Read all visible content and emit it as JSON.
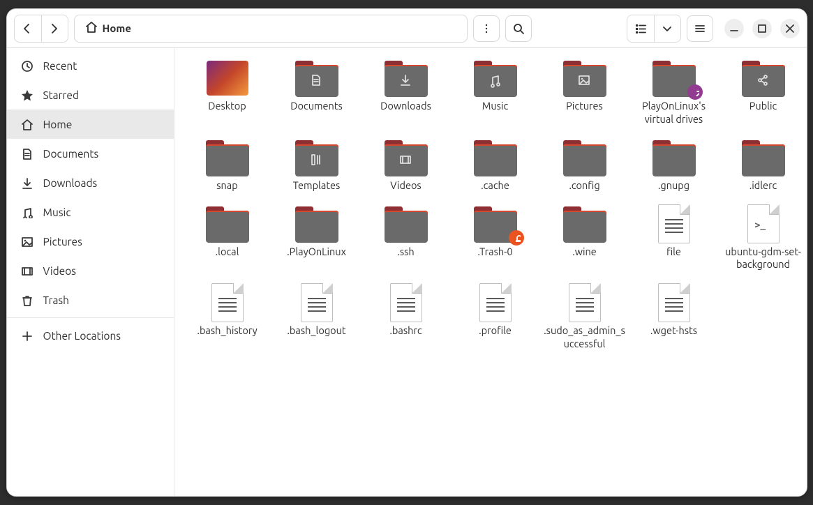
{
  "path": {
    "current": "Home"
  },
  "sidebar": {
    "items": [
      {
        "id": "recent",
        "label": "Recent",
        "icon": "clock"
      },
      {
        "id": "starred",
        "label": "Starred",
        "icon": "star"
      },
      {
        "id": "home",
        "label": "Home",
        "icon": "home",
        "active": true
      },
      {
        "id": "documents",
        "label": "Documents",
        "icon": "doc"
      },
      {
        "id": "downloads",
        "label": "Downloads",
        "icon": "download"
      },
      {
        "id": "music",
        "label": "Music",
        "icon": "music"
      },
      {
        "id": "pictures",
        "label": "Pictures",
        "icon": "picture"
      },
      {
        "id": "videos",
        "label": "Videos",
        "icon": "video"
      },
      {
        "id": "trash",
        "label": "Trash",
        "icon": "trash"
      }
    ],
    "other_locations": "Other Locations"
  },
  "items": [
    {
      "label": "Desktop",
      "type": "desktop"
    },
    {
      "label": "Documents",
      "type": "folder",
      "glyph": "doc"
    },
    {
      "label": "Downloads",
      "type": "folder",
      "glyph": "download"
    },
    {
      "label": "Music",
      "type": "folder",
      "glyph": "music"
    },
    {
      "label": "Pictures",
      "type": "folder",
      "glyph": "picture"
    },
    {
      "label": "PlayOnLinux's virtual drives",
      "type": "folder",
      "emblem": "link"
    },
    {
      "label": "Public",
      "type": "folder",
      "glyph": "share"
    },
    {
      "label": "snap",
      "type": "folder"
    },
    {
      "label": "Templates",
      "type": "folder",
      "glyph": "templates"
    },
    {
      "label": "Videos",
      "type": "folder",
      "glyph": "video"
    },
    {
      "label": ".cache",
      "type": "folder"
    },
    {
      "label": ".config",
      "type": "folder"
    },
    {
      "label": ".gnupg",
      "type": "folder"
    },
    {
      "label": ".idlerc",
      "type": "folder"
    },
    {
      "label": ".local",
      "type": "folder"
    },
    {
      "label": ".PlayOnLinux",
      "type": "folder"
    },
    {
      "label": ".ssh",
      "type": "folder"
    },
    {
      "label": ".Trash-0",
      "type": "folder",
      "emblem": "lock"
    },
    {
      "label": ".wine",
      "type": "folder"
    },
    {
      "label": "file",
      "type": "text"
    },
    {
      "label": "ubuntu-gdm-set-background",
      "type": "script"
    },
    {
      "label": ".bash_history",
      "type": "text"
    },
    {
      "label": ".bash_logout",
      "type": "text"
    },
    {
      "label": ".bashrc",
      "type": "text"
    },
    {
      "label": ".profile",
      "type": "text"
    },
    {
      "label": ".sudo_as_admin_successful",
      "type": "text"
    },
    {
      "label": ".wget-hsts",
      "type": "text"
    }
  ]
}
